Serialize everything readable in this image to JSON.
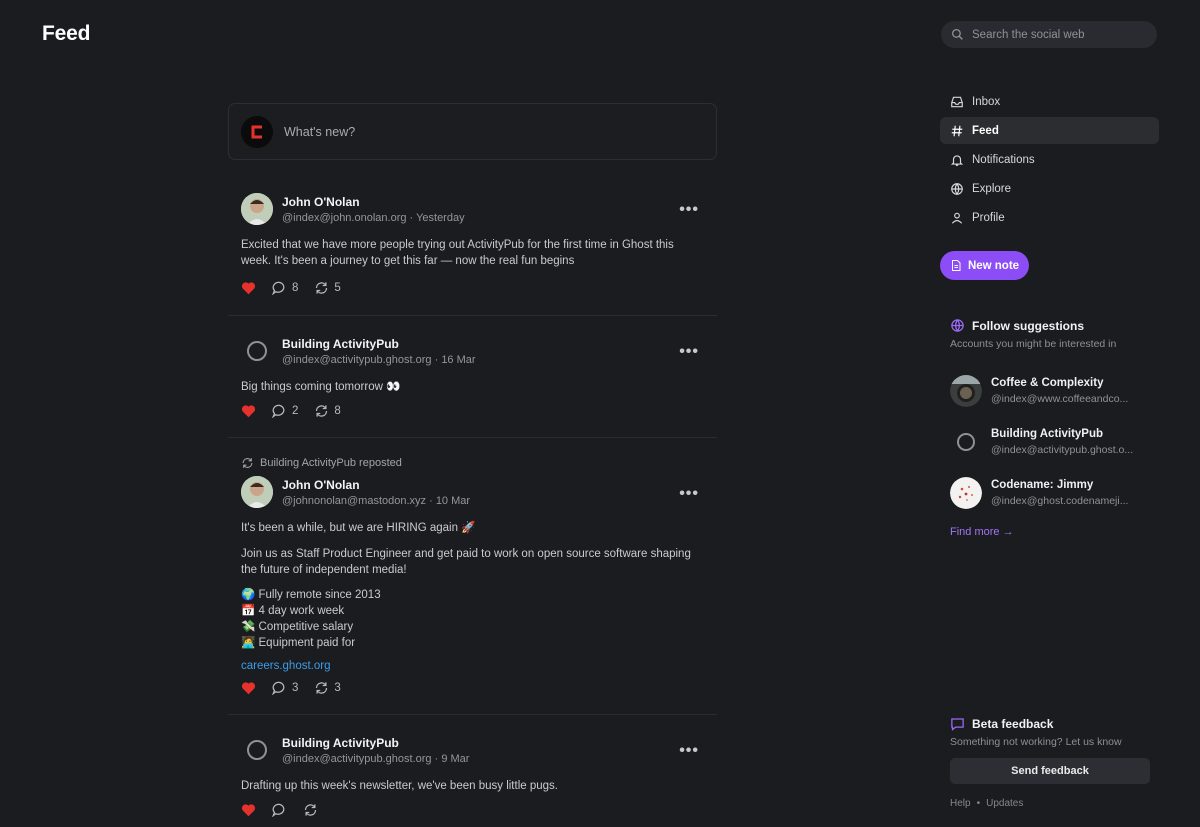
{
  "page": {
    "title": "Feed"
  },
  "composer": {
    "placeholder": "What's new?"
  },
  "search": {
    "placeholder": "Search the social web"
  },
  "nav": {
    "items": [
      {
        "label": "Inbox",
        "icon": "inbox-icon",
        "active": false
      },
      {
        "label": "Feed",
        "icon": "hash-icon",
        "active": true
      },
      {
        "label": "Notifications",
        "icon": "bell-icon",
        "active": false
      },
      {
        "label": "Explore",
        "icon": "globe-icon",
        "active": false
      },
      {
        "label": "Profile",
        "icon": "user-icon",
        "active": false
      }
    ]
  },
  "new_note": {
    "label": "New note"
  },
  "posts": [
    {
      "author": "John O'Nolan",
      "handle": "@index@john.onolan.org",
      "time": "Yesterday",
      "avatar": "photo",
      "paragraphs": [
        "Excited that we have more people trying out ActivityPub for the first time in Ghost this week. It's been a journey to get this far — now the real fun begins"
      ],
      "likes": "",
      "replies": "8",
      "reposts": "5"
    },
    {
      "author": "Building ActivityPub",
      "handle": "@index@activitypub.ghost.org",
      "time": "16 Mar",
      "avatar": "ring",
      "paragraphs": [
        "Big things coming tomorrow 👀"
      ],
      "likes": "",
      "replies": "2",
      "reposts": "8"
    },
    {
      "repost_note": "Building ActivityPub reposted",
      "author": "John O'Nolan",
      "handle": "@johnonolan@mastodon.xyz",
      "time": "10 Mar",
      "avatar": "photo",
      "paragraphs": [
        "It's been a while, but we are HIRING again 🚀",
        "Join us as Staff Product Engineer and get paid to work on open source software shaping the future of independent media!",
        "🌍 Fully remote since 2013",
        "📅 4 day work week",
        "💸 Competitive salary",
        "🧑‍💻 Equipment paid for"
      ],
      "link": "careers.ghost.org",
      "likes": "",
      "replies": "3",
      "reposts": "3"
    },
    {
      "author": "Building ActivityPub",
      "handle": "@index@activitypub.ghost.org",
      "time": "9 Mar",
      "avatar": "ring",
      "paragraphs": [
        "Drafting up this week's newsletter, we've been busy little pugs."
      ],
      "likes": "",
      "replies": "",
      "reposts": ""
    }
  ],
  "suggestions": {
    "title": "Follow suggestions",
    "subtitle": "Accounts you might be interested in",
    "items": [
      {
        "name": "Coffee & Complexity",
        "handle": "@index@www.coffeeandco..."
      },
      {
        "name": "Building ActivityPub",
        "handle": "@index@activitypub.ghost.o..."
      },
      {
        "name": "Codename: Jimmy",
        "handle": "@index@ghost.codenameji..."
      }
    ],
    "find_more": "Find more →"
  },
  "feedback": {
    "title": "Beta feedback",
    "subtitle": "Something not working? Let us know",
    "button": "Send feedback"
  },
  "footer": {
    "help": "Help",
    "sep": "•",
    "updates": "Updates"
  },
  "colors": {
    "accent": "#8c4cf6",
    "like": "#e5322c",
    "link": "#3d9ce8",
    "background": "#1b1c1f"
  }
}
